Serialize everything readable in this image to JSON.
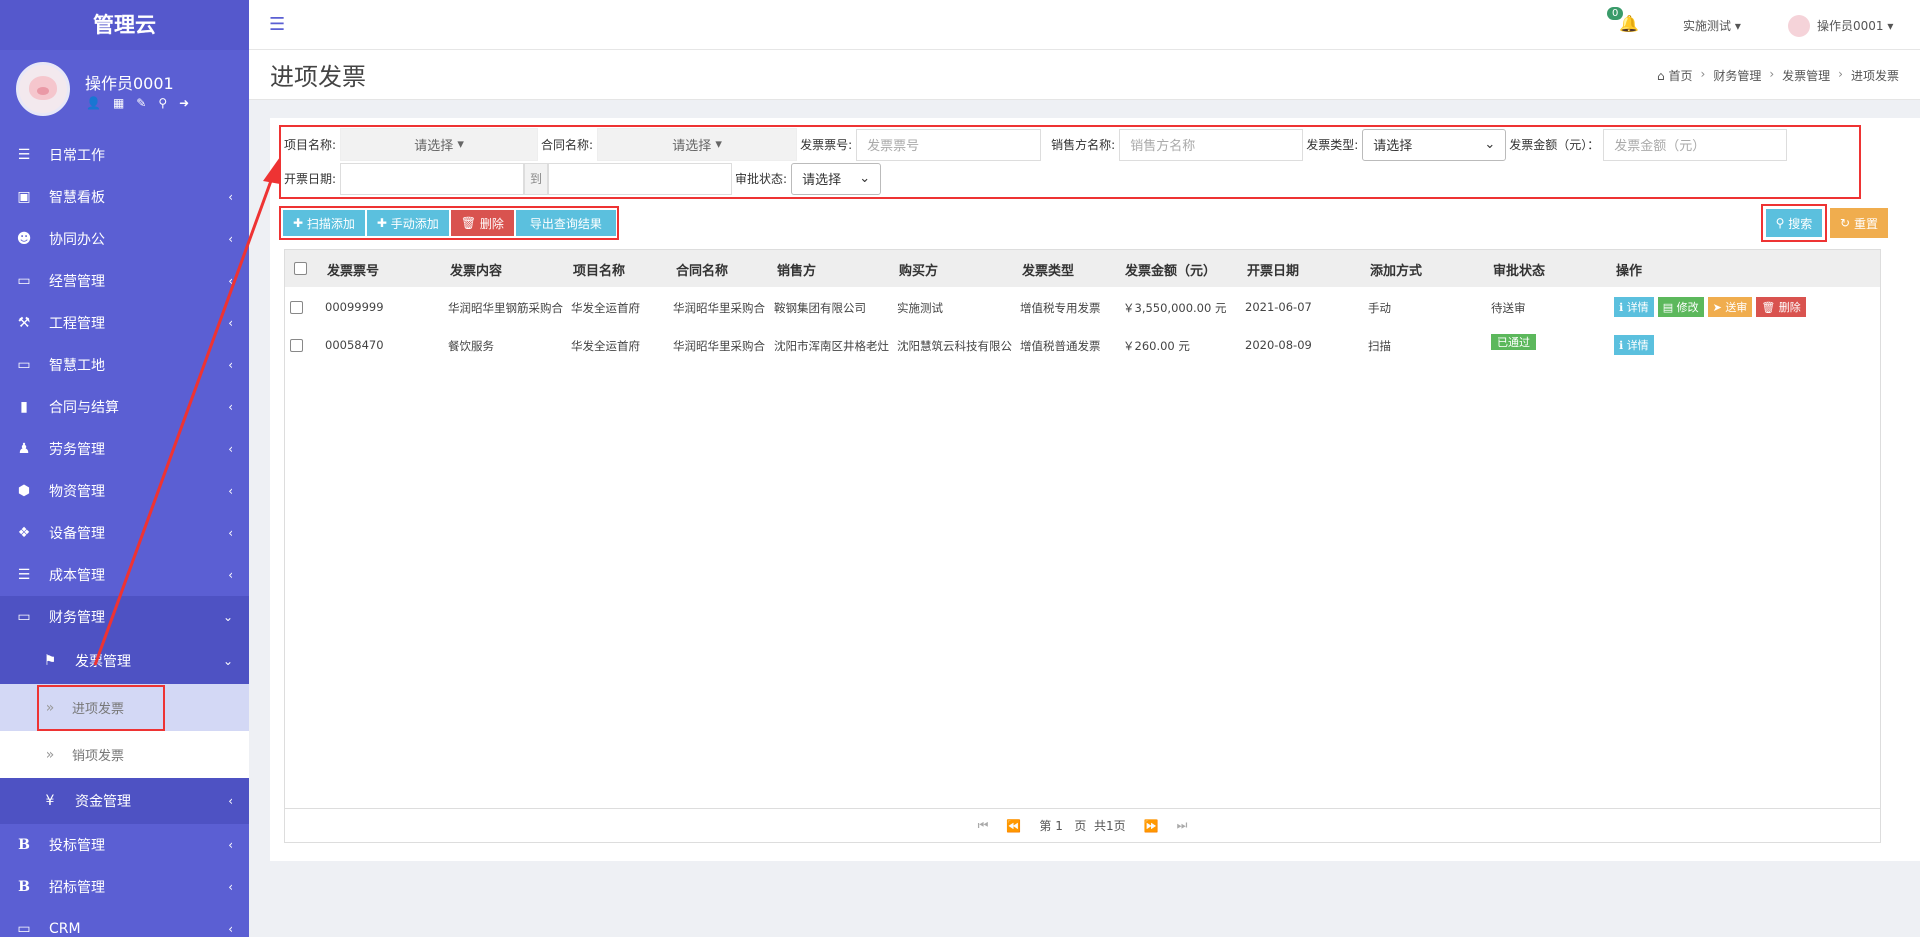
{
  "app": {
    "brand": "管理云",
    "username": "操作员0001"
  },
  "sidebar": {
    "items": [
      {
        "label": "日常工作"
      },
      {
        "label": "智慧看板"
      },
      {
        "label": "协同办公"
      },
      {
        "label": "经营管理"
      },
      {
        "label": "工程管理"
      },
      {
        "label": "智慧工地"
      },
      {
        "label": "合同与结算"
      },
      {
        "label": "劳务管理"
      },
      {
        "label": "物资管理"
      },
      {
        "label": "设备管理"
      },
      {
        "label": "成本管理"
      },
      {
        "label": "财务管理"
      },
      {
        "label": "发票管理"
      },
      {
        "label": "进项发票"
      },
      {
        "label": "销项发票"
      },
      {
        "label": "资金管理"
      },
      {
        "label": "投标管理"
      },
      {
        "label": "招标管理"
      },
      {
        "label": "CRM"
      }
    ]
  },
  "topbar": {
    "notification_count": "0",
    "org": "实施测试",
    "user": "操作员0001"
  },
  "page": {
    "title": "进项发票",
    "breadcrumb": [
      "首页",
      "财务管理",
      "发票管理",
      "进项发票"
    ]
  },
  "filter": {
    "project_label": "项目名称:",
    "project_value": "请选择",
    "contract_label": "合同名称:",
    "contract_value": "请选择",
    "invoice_no_label": "发票票号:",
    "invoice_no_placeholder": "发票票号",
    "seller_label": "销售方名称:",
    "seller_placeholder": "销售方名称",
    "type_label": "发票类型:",
    "type_value": "请选择",
    "amount_label": "发票金额（元）：",
    "amount_placeholder": "发票金额（元）",
    "date_label": "开票日期:",
    "to_label": "到",
    "approval_label": "审批状态:",
    "approval_value": "请选择"
  },
  "actions": {
    "scan_add": "扫描添加",
    "manual_add": "手动添加",
    "delete": "删除",
    "export": "导出查询结果",
    "search": "搜索",
    "reset": "重置"
  },
  "table": {
    "headers": [
      "发票票号",
      "发票内容",
      "项目名称",
      "合同名称",
      "销售方",
      "购买方",
      "发票类型",
      "发票金额（元）",
      "开票日期",
      "添加方式",
      "审批状态",
      "操作"
    ],
    "rows": [
      {
        "invoice_no": "00099999",
        "content": "华润昭华里钢筋采购合",
        "project": "华发全运首府",
        "contract": "华润昭华里采购合",
        "seller": "鞍钢集团有限公司",
        "buyer": "实施测试",
        "type": "增值税专用发票",
        "amount": "￥3,550,000.00 元",
        "date": "2021-06-07",
        "method": "手动",
        "status": "待送审",
        "ops": [
          "详情",
          "修改",
          "送审",
          "删除"
        ]
      },
      {
        "invoice_no": "00058470",
        "content": "餐饮服务",
        "project": "华发全运首府",
        "contract": "华润昭华里采购合",
        "seller": "沈阳市浑南区井格老灶",
        "buyer": "沈阳慧筑云科技有限公",
        "type": "增值税普通发票",
        "amount": "￥260.00 元",
        "date": "2020-08-09",
        "method": "扫描",
        "status": "已通过",
        "ops": [
          "详情"
        ]
      }
    ]
  },
  "pager": {
    "page_prefix": "第",
    "page_num": "1",
    "page_suffix": "页",
    "total": "共1页"
  },
  "colors": {
    "sidebar": "#5b5fd3",
    "info": "#5bc0de",
    "success": "#5cb85c",
    "warning": "#f0ad4e",
    "danger": "#d9534f",
    "annotation": "#e33"
  }
}
